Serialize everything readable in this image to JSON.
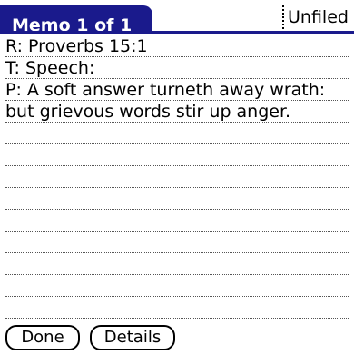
{
  "header": {
    "title": "Memo 1 of 1",
    "category": "Unfiled"
  },
  "memo": {
    "lines": [
      "R: Proverbs 15:1",
      "T: Speech:",
      "P: A soft answer turneth away wrath:",
      "but grievous words stir up anger.",
      "",
      "",
      "",
      "",
      "",
      "",
      "",
      "",
      ""
    ]
  },
  "buttons": {
    "done_label": "Done",
    "details_label": "Details"
  },
  "colors": {
    "title_bar": "#1a1a8c",
    "background": "#ffffff",
    "text": "#000000"
  }
}
